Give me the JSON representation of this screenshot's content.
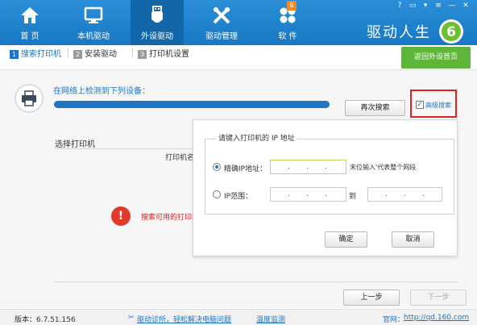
{
  "header": {
    "nav": [
      {
        "label": "首 页",
        "icon": "home-icon"
      },
      {
        "label": "本机驱动",
        "icon": "monitor-icon"
      },
      {
        "label": "外设驱动",
        "icon": "usb-icon",
        "active": true
      },
      {
        "label": "驱动管理",
        "icon": "tools-icon"
      },
      {
        "label": "软 件",
        "icon": "apps-icon",
        "badge": "6"
      }
    ],
    "brand": "驱动人生",
    "logo_digit": "6",
    "window_controls": [
      "?",
      "▭",
      "▾",
      "≡",
      "—",
      "✕"
    ]
  },
  "steps": [
    {
      "num": "1",
      "label": "搜索打印机",
      "active": true
    },
    {
      "num": "2",
      "label": "安装驱动",
      "active": false
    },
    {
      "num": "3",
      "label": "打印机设置",
      "active": false
    }
  ],
  "return_button": "返回外设首页",
  "detect": {
    "message": "在网络上检测到下列设备：",
    "progress": 1.0,
    "research_button": "再次搜索",
    "advanced_label": "高级搜索",
    "advanced_checked": true
  },
  "printer_list": {
    "select_label": "选择打印机",
    "name_col": "打印机名",
    "error_text": "搜索可用的打印机"
  },
  "ip_dialog": {
    "legend": "请键入打印机的 IP 地址",
    "exact_label": "精确IP地址：",
    "exact_hint": "末位输入'代表整个网段",
    "range_label": "IP范围：",
    "range_to": "到",
    "ok_button": "确定",
    "cancel_button": "取消",
    "selected": "exact"
  },
  "nav_buttons": {
    "prev": "上一步",
    "next": "下一步"
  },
  "footer": {
    "version": "版本：6.7.51.156",
    "diag_link": "驱动诊所，轻松解决电脑问题",
    "temp_link": "温度监测",
    "website_prefix": "官网：",
    "website": "http://qd.160.com"
  },
  "colors": {
    "header_blue": "#1f7fcc",
    "accent_blue": "#1f74c4",
    "green": "#5fb43a",
    "red": "#e02020"
  }
}
